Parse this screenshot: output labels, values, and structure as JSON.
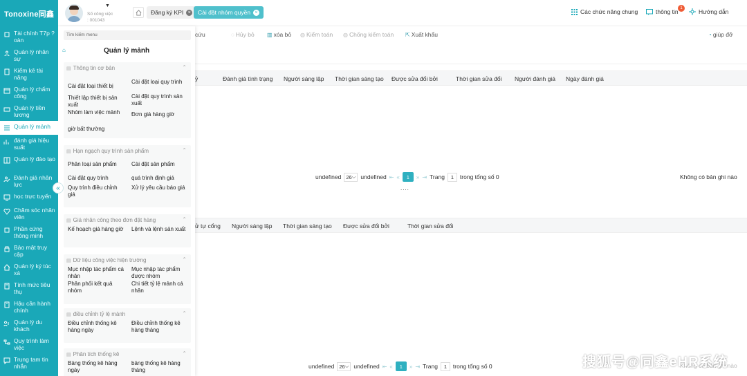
{
  "app": {
    "logo": "Tonoxine同鑫"
  },
  "sidebar": {
    "items": [
      {
        "label": "Tài chính T7p ? oàn",
        "icon": "finance-icon"
      },
      {
        "label": "Quản lý nhân sự",
        "icon": "person-icon"
      },
      {
        "label": "Kiểm kê tài năng",
        "icon": "clipboard-icon"
      },
      {
        "label": "Quản lý chấm công",
        "icon": "calendar-icon"
      },
      {
        "label": "Quản lý tiền lương",
        "icon": "money-icon"
      },
      {
        "label": "Quản lý mảnh",
        "icon": "list-icon",
        "active": true
      },
      {
        "label": "đánh giá hiệu suất",
        "icon": "chart-icon"
      },
      {
        "label": "Quản lý đào tạo",
        "icon": "book-icon"
      },
      {
        "label": "Đánh giá nhân lực",
        "icon": "user-check-icon"
      },
      {
        "label": "học trực tuyến",
        "icon": "screen-icon"
      },
      {
        "label": "Chăm sóc nhân viên",
        "icon": "heart-icon"
      },
      {
        "label": "Phần cứng thông minh",
        "icon": "chip-icon"
      },
      {
        "label": "Bảo mật truy cập",
        "icon": "lock-icon"
      },
      {
        "label": "Quản lý ký túc xá",
        "icon": "home-icon"
      },
      {
        "label": "Tính mức tiêu thụ",
        "icon": "calculator-icon"
      },
      {
        "label": "Hậu cần hành chính",
        "icon": "building-icon"
      },
      {
        "label": "Quản lý du khách",
        "icon": "visitor-icon"
      },
      {
        "label": "Quy trình làm việc",
        "icon": "flow-icon"
      },
      {
        "label": "Trung tam tin nhắn",
        "icon": "message-icon"
      }
    ]
  },
  "topbar": {
    "user_sub": "Số công việc : 001043",
    "tabs": [
      {
        "label": "Đăng ký KPI"
      },
      {
        "label": "Cài đặt nhóm quyền"
      }
    ],
    "common_functions": "Các chức năng chung",
    "notifications": "thông tin",
    "notification_count": "1",
    "guide": "Hướng dẫn"
  },
  "toolbar": {
    "buttons": [
      "cứu",
      "Hủy bỏ",
      "xóa bỏ",
      "Kiểm toán",
      "Chống kiểm toán",
      "Xuất khẩu"
    ],
    "help": "giúp đỡ"
  },
  "dropdown": {
    "search_placeholder": "Tìm kiếm menu",
    "title": "Quản lý mảnh",
    "groups": [
      {
        "title": "Thông tin cơ bản",
        "items": [
          "Cài đặt loại thiết bị",
          "Cài đặt loại quy trình",
          "Thiết lập thiết bị sản xuất",
          "Cài đặt quy trình sản xuất",
          "Nhóm làm việc mảnh",
          "Đơn giá hàng giờ",
          "giờ bất thường"
        ]
      },
      {
        "title": "Hạn ngạch quy trình sản phẩm",
        "items": [
          "Phân loại sản phẩm",
          "Cài đặt sản phẩm",
          "Cài đặt quy trình",
          "quá trình định giá",
          "Quy trình điều chỉnh giá",
          "Xử lý yêu cầu báo giá"
        ]
      },
      {
        "title": "Giá nhân công theo đơn đặt hàng",
        "items": [
          "Kế hoạch giá hàng giờ",
          "Lệnh và lệnh sản xuất"
        ]
      },
      {
        "title": "Dữ liệu công việc hiện trường",
        "items": [
          "Mục nhập tác phẩm cá nhân",
          "Mục nhập tác phẩm được nhóm",
          "Phân phối kết quả nhóm",
          "Chi tiết tỷ lệ mảnh cá nhân"
        ]
      },
      {
        "title": "điều chỉnh tỷ lệ mảnh",
        "items": [
          "Điều chỉnh thống kê hàng ngày",
          "Điều chỉnh thống kê hàng tháng"
        ]
      },
      {
        "title": "Phân tích thống kê",
        "items": [
          "Bảng thống kê hàng ngày",
          "bảng thống kê hàng tháng"
        ]
      }
    ]
  },
  "table1": {
    "headers": [
      "ỷ",
      "Đánh giá tình trạng",
      "Người sáng lập",
      "Thời gian sáng tạo",
      "Được sửa đổi bởi",
      "Thời gian sửa đổi",
      "Người đánh giá",
      "Ngày đánh giá"
    ],
    "pager": {
      "left": "undefined",
      "size": "26",
      "right": "undefined",
      "page": "1",
      "label_page": "Trang",
      "page_input": "1",
      "total": "trong tổng số 0"
    },
    "no_records": "Không có bản ghi nào",
    "more": "...."
  },
  "table2": {
    "headers": [
      "ử tự cổng",
      "Người sáng lập",
      "Thời gian sáng tạo",
      "Được sửa đổi bởi",
      "Thời gian sửa đổi"
    ],
    "pager": {
      "left": "undefined",
      "size": "26",
      "right": "undefined",
      "page": "1",
      "label_page": "Trang",
      "page_input": "1",
      "total": "trong tổng số 0"
    },
    "no_records": "Không có bản ghi nào"
  },
  "watermark": "搜狐号@同鑫eHR系统",
  "colors": {
    "primary": "#1aa8b8",
    "accent_tab": "#4fc0cc",
    "badge": "#ef5b35"
  }
}
